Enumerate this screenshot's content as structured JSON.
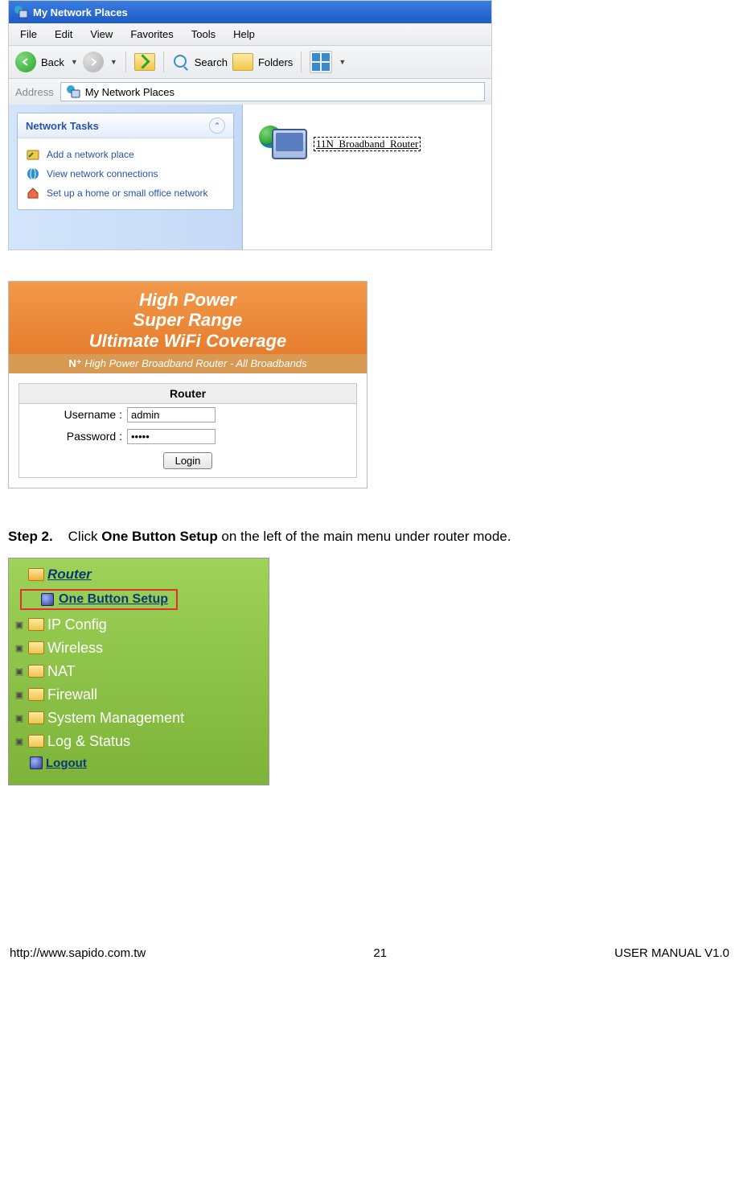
{
  "explorer": {
    "title": "My Network Places",
    "menubar": [
      "File",
      "Edit",
      "View",
      "Favorites",
      "Tools",
      "Help"
    ],
    "toolbar": {
      "back": "Back",
      "search": "Search",
      "folders": "Folders"
    },
    "address_label": "Address",
    "address_value": "My Network Places",
    "tasks": {
      "header": "Network Tasks",
      "items": [
        "Add a network place",
        "View network connections",
        "Set up a home or small office network"
      ]
    },
    "upnp_device": "11N_Broadband_Router"
  },
  "login": {
    "banner_line1": "High Power",
    "banner_line2": "Super Range",
    "banner_line3": "Ultimate WiFi Coverage",
    "subbanner": "High Power Broadband Router - All Broadbands",
    "subbanner_prefix": "N⁺",
    "table_header": "Router",
    "username_label": "Username :",
    "username_value": "admin",
    "password_label": "Password :",
    "password_value": "•••••",
    "login_button": "Login"
  },
  "step": {
    "label": "Step 2.",
    "text_before": "Click ",
    "emph": "One Button Setup",
    "text_after": " on the left of the main menu under router mode."
  },
  "router_menu": {
    "router": "Router",
    "one_button": "One Button Setup",
    "items": [
      "IP Config",
      "Wireless",
      "NAT",
      "Firewall",
      "System Management",
      "Log & Status"
    ],
    "logout": "Logout"
  },
  "footer": {
    "url": "http://www.sapido.com.tw",
    "page": "21",
    "right": "USER MANUAL V1.0"
  }
}
